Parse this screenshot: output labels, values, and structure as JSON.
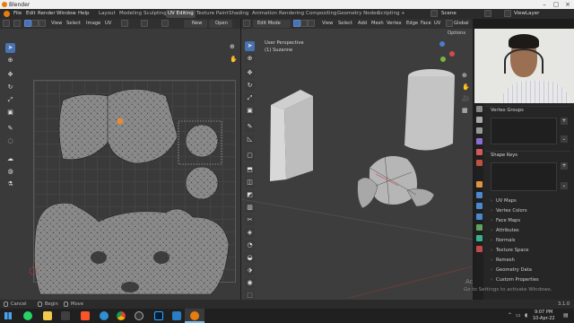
{
  "window": {
    "title": "Blender"
  },
  "menubar": {
    "items": [
      "File",
      "Edit",
      "Render",
      "Window",
      "Help"
    ],
    "workspaces": [
      "Layout",
      "Modeling",
      "Sculpting",
      "UV Editing",
      "Texture Paint",
      "Shading",
      "Animation",
      "Rendering",
      "Compositing",
      "Geometry Nodes",
      "Scripting"
    ],
    "active_workspace": "UV Editing",
    "scene": "Scene",
    "view_layer": "ViewLayer"
  },
  "uv_header": {
    "view": "View",
    "select": "Select",
    "image": "Image",
    "uv": "UV",
    "new_label": "New",
    "open_label": "Open"
  },
  "viewport_header": {
    "mode": "Edit Mode",
    "view": "View",
    "select": "Select",
    "add": "Add",
    "mesh": "Mesh",
    "vertex": "Vertex",
    "edge": "Edge",
    "face": "Face",
    "uv": "UV",
    "orientation": "Global",
    "options": "Options"
  },
  "viewport_overlay": {
    "perspective": "User Perspective",
    "object": "(1) Suzanne"
  },
  "properties": {
    "vertex_groups": "Vertex Groups",
    "shape_keys": "Shape Keys",
    "sections": [
      "UV Maps",
      "Vertex Colors",
      "Face Maps",
      "Attributes",
      "Normals",
      "Texture Space",
      "Remesh",
      "Geometry Data",
      "Custom Properties"
    ]
  },
  "statusbar": {
    "cancel": "Cancel",
    "begin": "Begin",
    "move": "Move",
    "version": "3.1.0"
  },
  "watermark": {
    "line1": "Activate Windows",
    "line2": "Go to Settings to activate Windows."
  },
  "taskbar": {
    "time": "9:07 PM",
    "date": "10-Apr-22"
  },
  "colors": {
    "accent": "#4772b3",
    "active_face": "#e88a3a",
    "header": "#303030"
  }
}
